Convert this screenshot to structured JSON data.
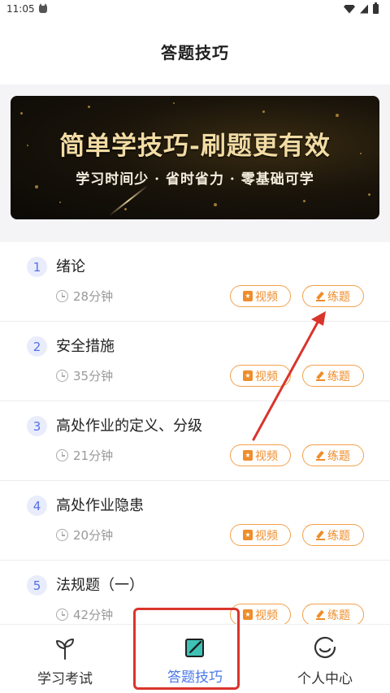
{
  "status_bar": {
    "time": "11:05"
  },
  "header": {
    "title": "答题技巧"
  },
  "banner": {
    "title": "简单学技巧-刷题更有效",
    "subtitle": "学习时间少 · 省时省力 · 零基础可学"
  },
  "lessons": [
    {
      "num": "1",
      "title": "绪论",
      "duration": "28分钟",
      "video_label": "视频",
      "practice_label": "练题"
    },
    {
      "num": "2",
      "title": "安全措施",
      "duration": "35分钟",
      "video_label": "视频",
      "practice_label": "练题"
    },
    {
      "num": "3",
      "title": "高处作业的定义、分级",
      "duration": "21分钟",
      "video_label": "视频",
      "practice_label": "练题"
    },
    {
      "num": "4",
      "title": "高处作业隐患",
      "duration": "20分钟",
      "video_label": "视频",
      "practice_label": "练题"
    },
    {
      "num": "5",
      "title": "法规题（一）",
      "duration": "42分钟",
      "video_label": "视频",
      "practice_label": "练题"
    }
  ],
  "tabbar": {
    "tabs": [
      {
        "label": "学习考试",
        "icon": "sprout-icon",
        "active": false
      },
      {
        "label": "答题技巧",
        "icon": "edit-icon",
        "active": true
      },
      {
        "label": "个人中心",
        "icon": "smile-icon",
        "active": false
      }
    ]
  },
  "colors": {
    "accent": "#4a78e8",
    "button_orange": "#ee8d2c",
    "badge_blue": "#5570e6",
    "annotation_red": "#d9352c"
  }
}
